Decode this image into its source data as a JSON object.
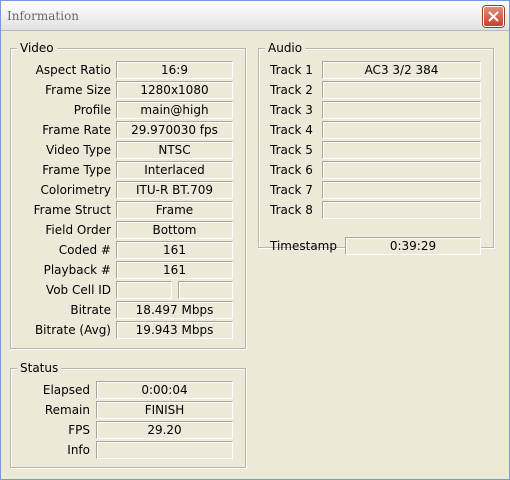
{
  "window": {
    "title": "Information"
  },
  "video": {
    "legend": "Video",
    "rows": [
      {
        "label": "Aspect Ratio",
        "value": "16:9"
      },
      {
        "label": "Frame Size",
        "value": "1280x1080"
      },
      {
        "label": "Profile",
        "value": "main@high"
      },
      {
        "label": "Frame Rate",
        "value": "29.970030 fps"
      },
      {
        "label": "Video Type",
        "value": "NTSC"
      },
      {
        "label": "Frame Type",
        "value": "Interlaced"
      },
      {
        "label": "Colorimetry",
        "value": "ITU-R BT.709"
      },
      {
        "label": "Frame Struct",
        "value": "Frame"
      },
      {
        "label": "Field Order",
        "value": "Bottom"
      },
      {
        "label": "Coded #",
        "value": "161"
      },
      {
        "label": "Playback #",
        "value": "161"
      },
      {
        "label": "Vob Cell ID",
        "value": "",
        "value2": ""
      },
      {
        "label": "Bitrate",
        "value": "18.497 Mbps"
      },
      {
        "label": "Bitrate (Avg)",
        "value": "19.943 Mbps"
      }
    ]
  },
  "audio": {
    "legend": "Audio",
    "rows": [
      {
        "label": "Track 1",
        "value": "AC3 3/2 384"
      },
      {
        "label": "Track 2",
        "value": ""
      },
      {
        "label": "Track 3",
        "value": ""
      },
      {
        "label": "Track 4",
        "value": ""
      },
      {
        "label": "Track 5",
        "value": ""
      },
      {
        "label": "Track 6",
        "value": ""
      },
      {
        "label": "Track 7",
        "value": ""
      },
      {
        "label": "Track 8",
        "value": ""
      }
    ],
    "timestamp": {
      "label": "Timestamp",
      "value": "0:39:29"
    }
  },
  "status": {
    "legend": "Status",
    "rows": [
      {
        "label": "Elapsed",
        "value": "0:00:04"
      },
      {
        "label": "Remain",
        "value": "FINISH"
      },
      {
        "label": "FPS",
        "value": "29.20"
      },
      {
        "label": "Info",
        "value": ""
      }
    ]
  },
  "icons": {
    "close": "close-icon"
  },
  "colors": {
    "close_button": "#c8412b",
    "window_bg": "#ece9d8"
  }
}
